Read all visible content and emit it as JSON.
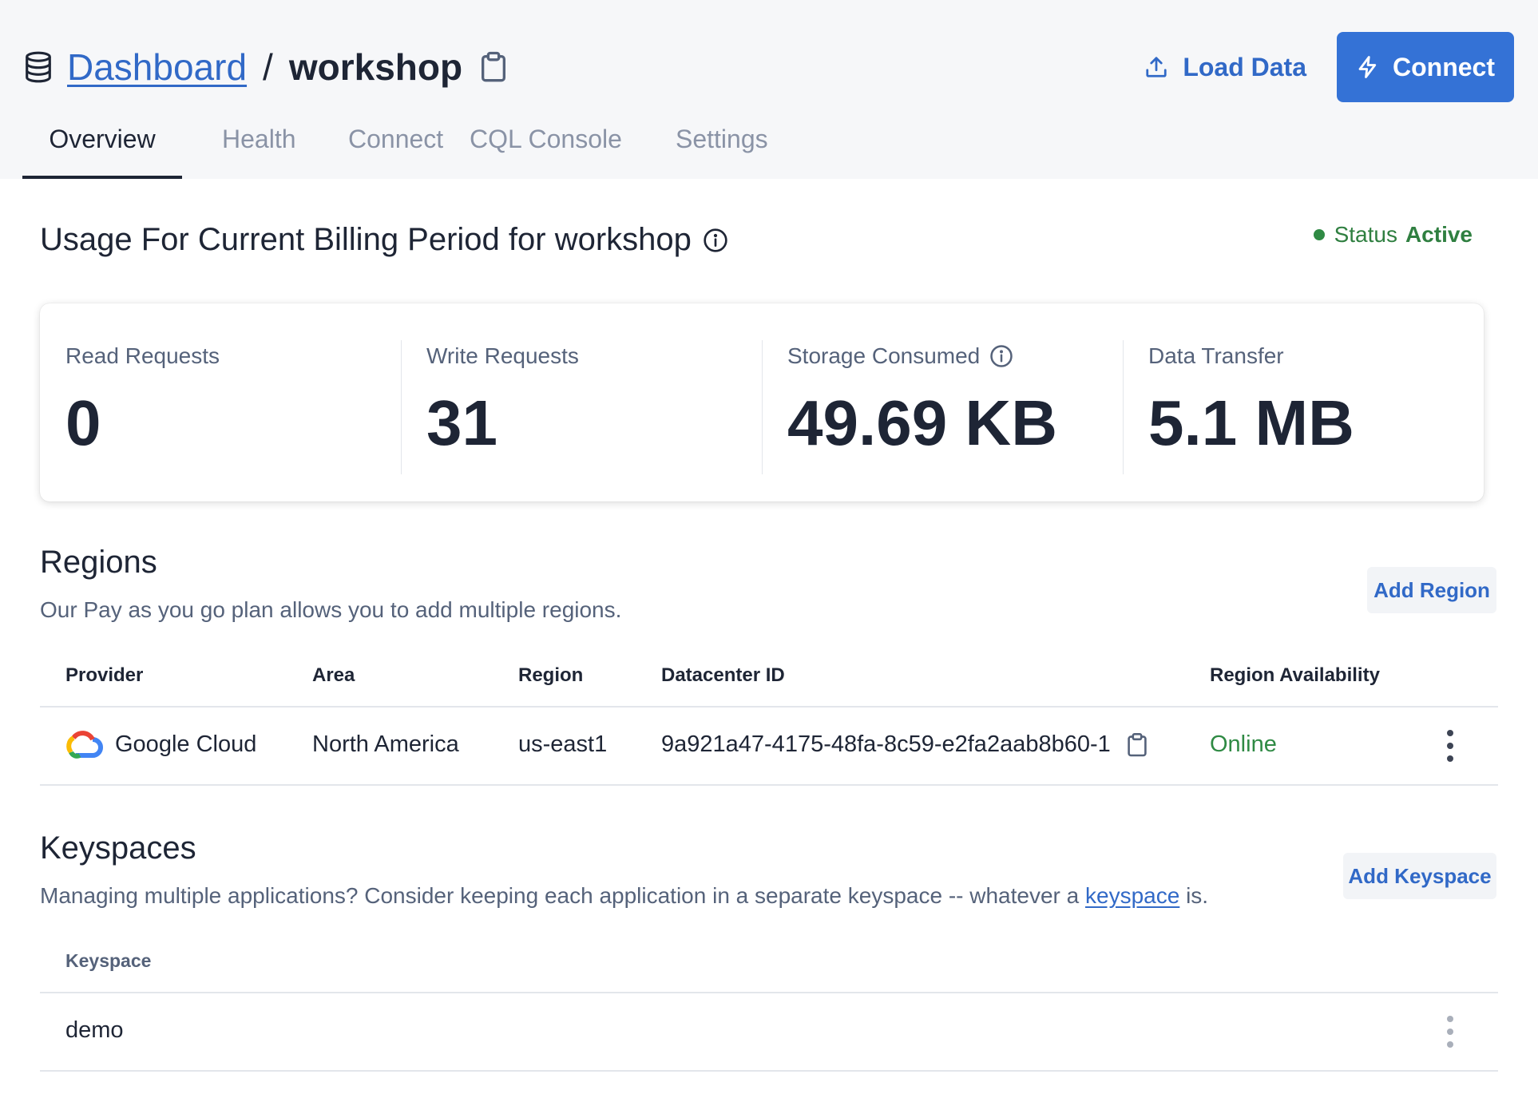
{
  "breadcrumb": {
    "root": "Dashboard",
    "separator": "/",
    "current": "workshop"
  },
  "header_actions": {
    "load_data": "Load Data",
    "connect": "Connect"
  },
  "tabs": [
    {
      "label": "Overview",
      "active": true
    },
    {
      "label": "Health",
      "active": false
    },
    {
      "label": "Connect",
      "active": false
    },
    {
      "label": "CQL Console",
      "active": false
    },
    {
      "label": "Settings",
      "active": false
    }
  ],
  "usage": {
    "title": "Usage For Current Billing Period for workshop",
    "status_label": "Status",
    "status_value": "Active",
    "status_color": "#2f8a44",
    "metrics": [
      {
        "label": "Read Requests",
        "value": "0"
      },
      {
        "label": "Write Requests",
        "value": "31"
      },
      {
        "label": "Storage Consumed",
        "value": "49.69 KB"
      },
      {
        "label": "Data Transfer",
        "value": "5.1 MB"
      }
    ]
  },
  "regions": {
    "title": "Regions",
    "description": "Our Pay as you go plan allows you to add multiple regions.",
    "add_button": "Add Region",
    "columns": [
      "Provider",
      "Area",
      "Region",
      "Datacenter ID",
      "Region Availability"
    ],
    "rows": [
      {
        "provider": "Google Cloud",
        "area": "North America",
        "region": "us-east1",
        "datacenter_id": "9a921a47-4175-48fa-8c59-e2fa2aab8b60-1",
        "availability": "Online"
      }
    ]
  },
  "keyspaces": {
    "title": "Keyspaces",
    "description_prefix": "Managing multiple applications? Consider keeping each application in a separate keyspace -- whatever a ",
    "description_link": "keyspace",
    "description_suffix": " is.",
    "add_button": "Add Keyspace",
    "columns": [
      "Keyspace"
    ],
    "rows": [
      {
        "name": "demo"
      }
    ]
  },
  "colors": {
    "accent": "#3472d6",
    "link": "#3169c7",
    "success": "#2f8a44",
    "header_bg": "#f6f7f9"
  },
  "icons": [
    "database-icon",
    "clipboard-icon",
    "upload-icon",
    "lightning-icon",
    "info-icon",
    "google-cloud-icon",
    "more-vertical-icon"
  ]
}
